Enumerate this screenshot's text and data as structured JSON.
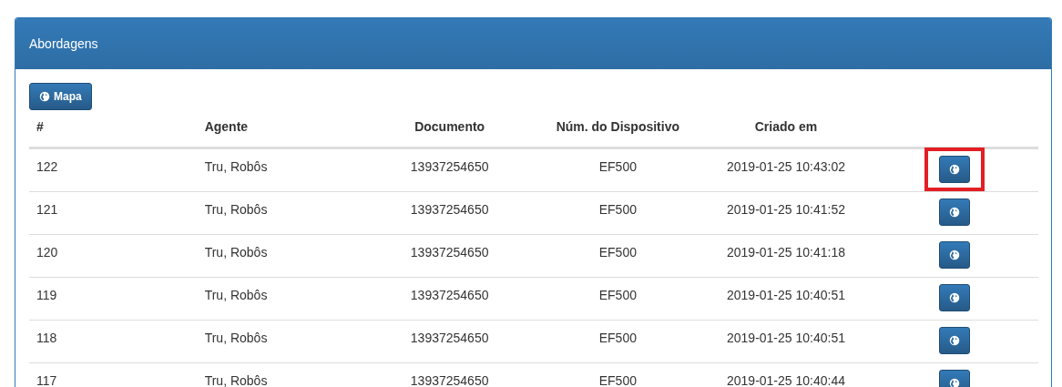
{
  "panel": {
    "title": "Abordagens"
  },
  "map_button": {
    "label": "Mapa"
  },
  "table": {
    "columns": [
      "#",
      "Agente",
      "Documento",
      "Núm. do Dispositivo",
      "Criado em"
    ],
    "rows": [
      {
        "id": "122",
        "agent": "Tru, Robôs",
        "document": "13937254650",
        "device": "EF500",
        "created": "2019-01-25 10:43:02",
        "highlighted": true
      },
      {
        "id": "121",
        "agent": "Tru, Robôs",
        "document": "13937254650",
        "device": "EF500",
        "created": "2019-01-25 10:41:52",
        "highlighted": false
      },
      {
        "id": "120",
        "agent": "Tru, Robôs",
        "document": "13937254650",
        "device": "EF500",
        "created": "2019-01-25 10:41:18",
        "highlighted": false
      },
      {
        "id": "119",
        "agent": "Tru, Robôs",
        "document": "13937254650",
        "device": "EF500",
        "created": "2019-01-25 10:40:51",
        "highlighted": false
      },
      {
        "id": "118",
        "agent": "Tru, Robôs",
        "document": "13937254650",
        "device": "EF500",
        "created": "2019-01-25 10:40:51",
        "highlighted": false
      },
      {
        "id": "117",
        "agent": "Tru, Robôs",
        "document": "13937254650",
        "device": "EF500",
        "created": "2019-01-25 10:40:44",
        "highlighted": false
      }
    ]
  }
}
